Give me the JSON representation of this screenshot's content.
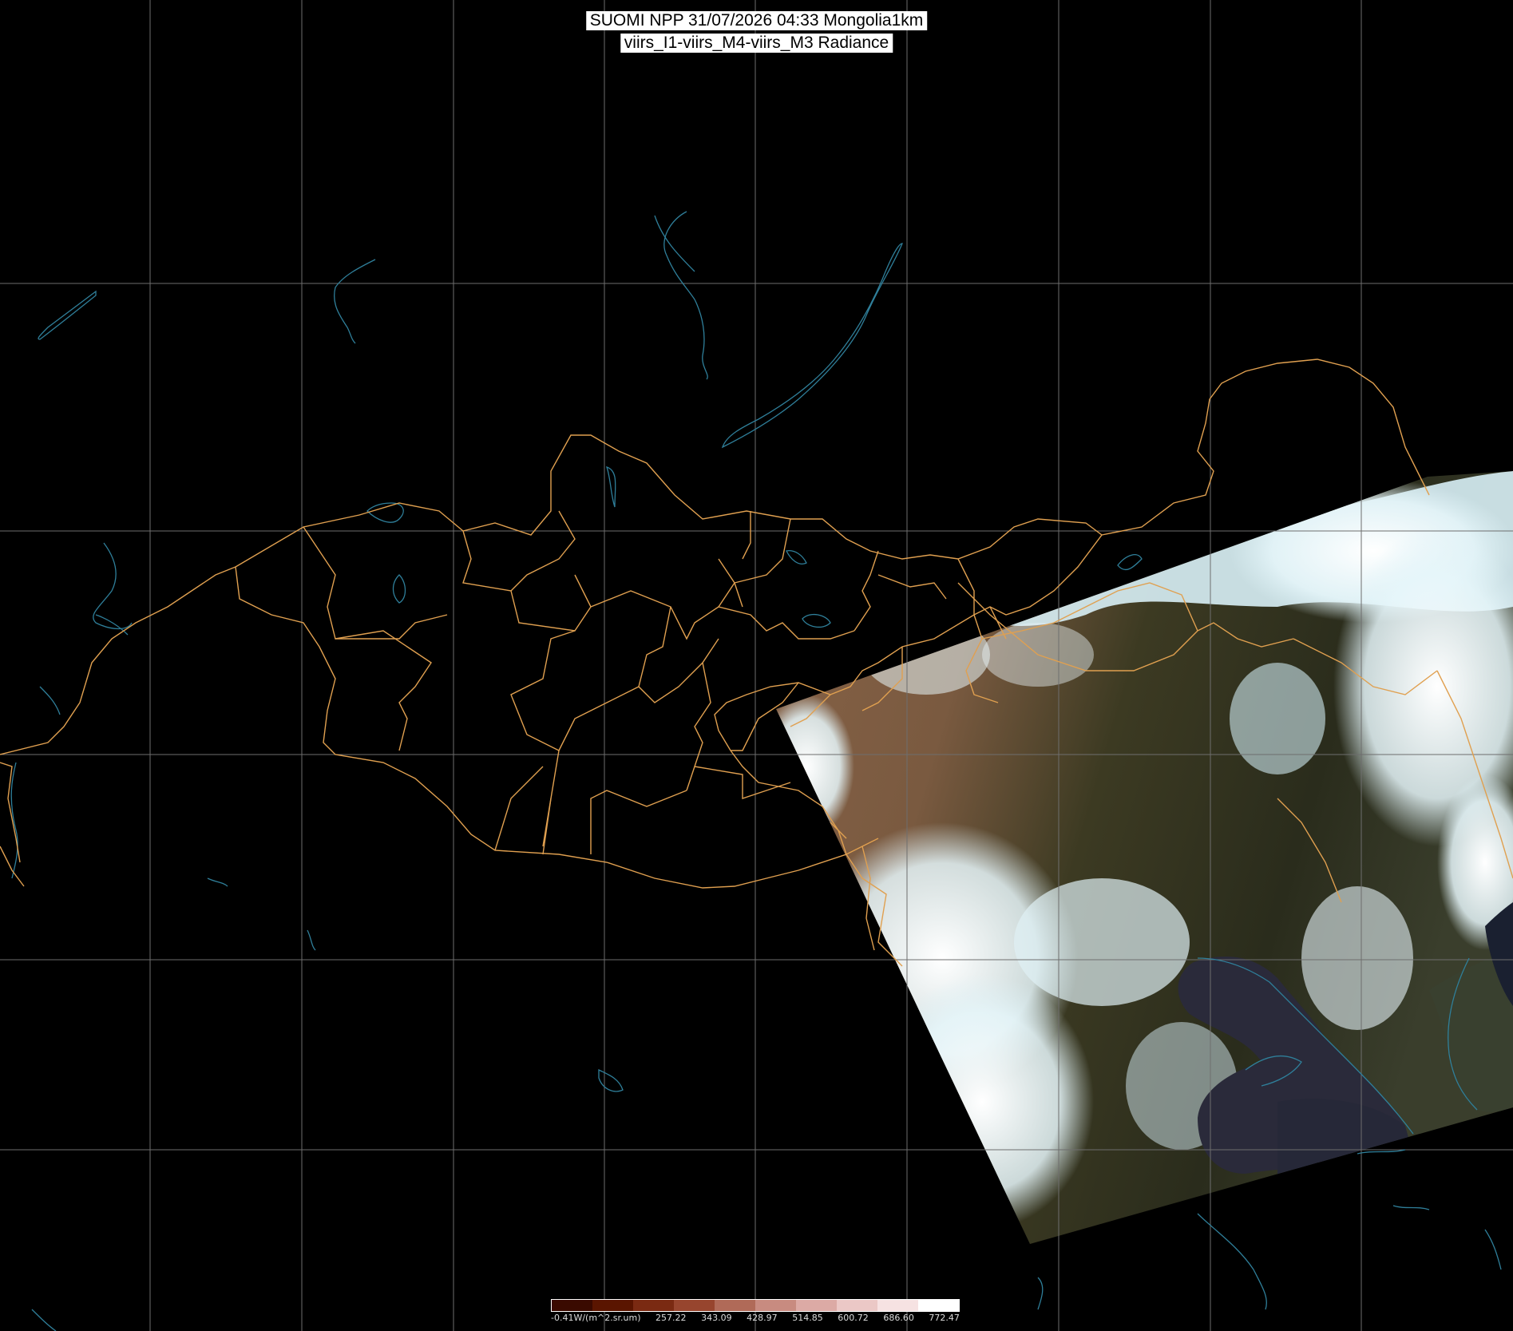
{
  "title": {
    "line1": "SUOMI NPP 31/07/2026 04:33 Mongolia1km",
    "line2": "viirs_I1-viirs_M4-viirs_M3 Radiance"
  },
  "colorbar": {
    "labels": [
      "-0.41W/(m^2.sr.um)",
      "257.22",
      "343.09",
      "428.97",
      "514.85",
      "600.72",
      "686.60",
      "772.47"
    ],
    "colors": [
      "#3a0a00",
      "#5a1500",
      "#7a2a12",
      "#97452e",
      "#b06a58",
      "#c88b80",
      "#dcaaa5",
      "#ebc8c6",
      "#f6e2e2",
      "#ffffff"
    ]
  },
  "colors": {
    "grid": "#6e6e6e",
    "borders": "#e0a050",
    "coast": "#2f7f9a"
  }
}
